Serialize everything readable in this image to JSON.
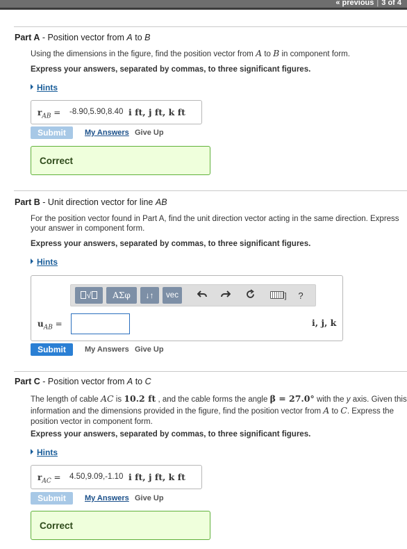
{
  "nav": {
    "previous": "« previous",
    "separator": "|",
    "position": "3 of 4"
  },
  "hints_label": "Hints",
  "submit_label": "Submit",
  "my_answers_label": "My Answers",
  "give_up_label": "Give Up",
  "correct_label": "Correct",
  "colors": {
    "link": "#1a5e9a",
    "submit_active": "#2a7fd4",
    "submit_disabled": "#a7c8e6",
    "correct_border": "#5fb039",
    "correct_bg": "#efffdc",
    "toolbar_button": "#7d8fa6"
  },
  "partA": {
    "label": "Part A",
    "title_pre": " - Position vector from ",
    "title_a": "A",
    "title_mid": " to ",
    "title_b": "B",
    "instr_pre": "Using the dimensions in the figure, find the position vector from ",
    "instr_a": "A",
    "instr_mid": " to ",
    "instr_b": "B",
    "instr_post": " in component form.",
    "express": "Express your answers, separated by commas, to three significant figures.",
    "var_symbol": "r",
    "var_sub": "AB",
    "equals": " = ",
    "answer": "-8.90,5.90,8.40",
    "units": "i ft, j ft, k ft"
  },
  "partB": {
    "label": "Part B",
    "title_rest": " - Unit direction vector for line ",
    "title_line": "AB",
    "instr": "For the position vector found in Part A, find the unit direction vector acting in the same direction. Express your answer in component form.",
    "express": "Express your answers, separated by commas, to three significant figures.",
    "toolbar": {
      "greek": "ΑΣφ",
      "subsup": "↓↑",
      "vec": "vec",
      "help": "?"
    },
    "icons": {
      "template": "template-icon",
      "undo": "undo-icon",
      "redo": "redo-icon",
      "reset": "reset-icon",
      "keyboard": "keyboard-icon"
    },
    "var_symbol": "u",
    "var_sub": "AB",
    "equals": " = ",
    "answer": "",
    "units": "i, j, k"
  },
  "partC": {
    "label": "Part C",
    "title_pre": " - Position vector from ",
    "title_a": "A",
    "title_mid": " to ",
    "title_c": "C",
    "instr_1": "The length of cable ",
    "instr_ac": "AC",
    "instr_2": " is ",
    "instr_len": "10.2 ft",
    "instr_3": " , and the cable forms the angle ",
    "instr_angle": "β = 27.0°",
    "instr_4": " with the ",
    "instr_y": "y",
    "instr_5": " axis. Given this information and the dimensions provided in the figure, find the position vector from ",
    "instr_a": "A",
    "instr_6": " to ",
    "instr_c": "C",
    "instr_7": ". Express the position vector in component form.",
    "express": "Express your answers, separated by commas, to three significant figures.",
    "var_symbol": "r",
    "var_sub": "AC",
    "equals": " = ",
    "answer": "4.50,9.09,-1.10",
    "units": "i ft, j ft, k ft"
  }
}
